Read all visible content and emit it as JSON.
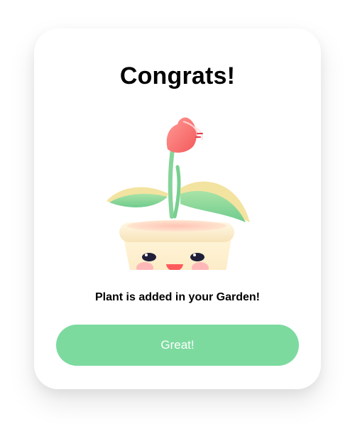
{
  "dialog": {
    "title": "Congrats!",
    "illustration_icon": "potted-plant-illustration-icon",
    "message": "Plant is added in your Garden!",
    "confirm_label": "Great!"
  },
  "colors": {
    "button": "#7dda9f",
    "button_text": "#ffffff",
    "card": "#ffffff",
    "text": "#000000"
  }
}
